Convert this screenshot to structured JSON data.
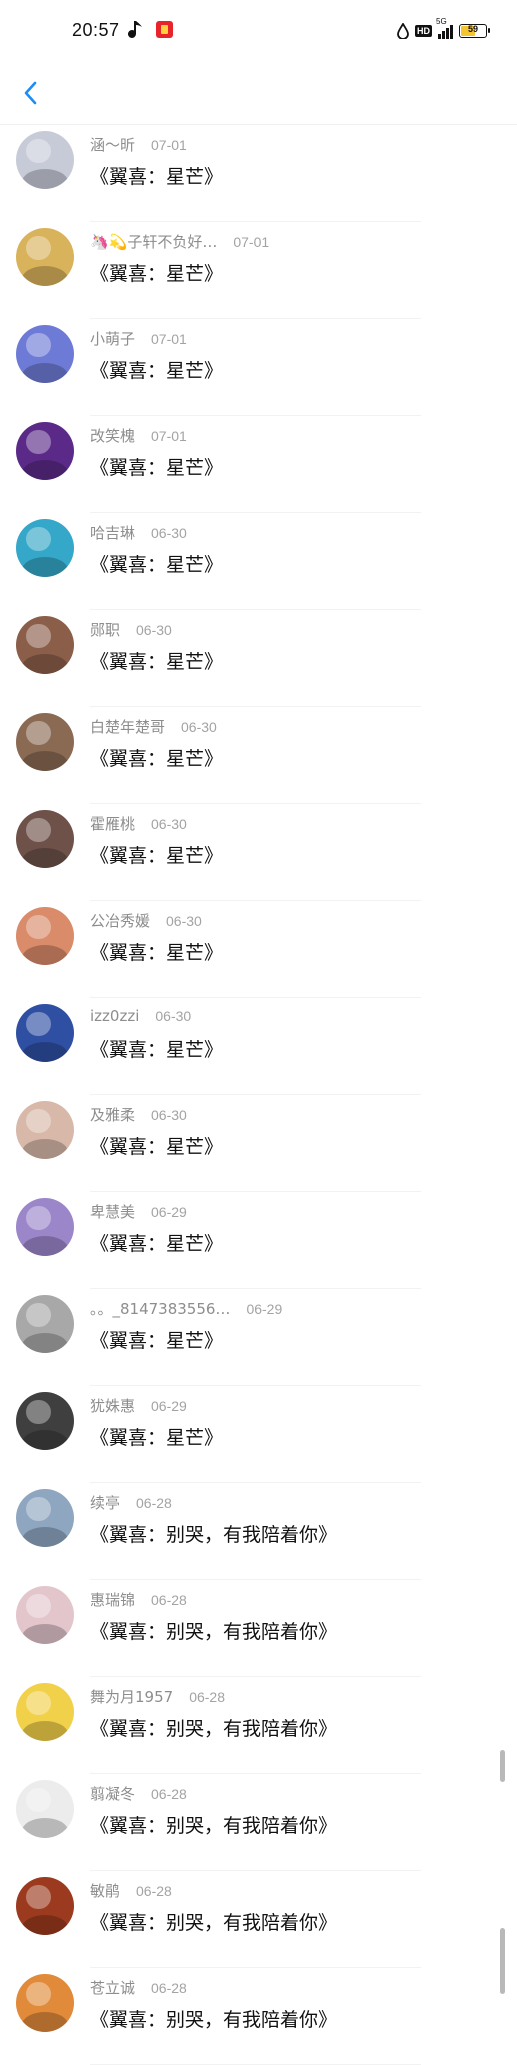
{
  "status_bar": {
    "time": "20:57",
    "network": "5G",
    "hd": "HD",
    "battery": "59",
    "battery_level": 0.59,
    "battery_color": "#f5c432"
  },
  "nav": {
    "back_icon": "chevron-left-icon",
    "accent": "#1a8ef5"
  },
  "comments": [
    {
      "name": "涵～昕",
      "date": "07-01",
      "title": "《翼喜：星芒》",
      "avatar_color": "#c7cbd8"
    },
    {
      "name": "🦄💫子轩不负好…",
      "date": "07-01",
      "title": "《翼喜：星芒》",
      "avatar_color": "#d9b35c"
    },
    {
      "name": "小萌子",
      "date": "07-01",
      "title": "《翼喜：星芒》",
      "avatar_color": "#6e7bd6"
    },
    {
      "name": "改笑槐",
      "date": "07-01",
      "title": "《翼喜：星芒》",
      "avatar_color": "#5b2a88"
    },
    {
      "name": "哈吉琳",
      "date": "06-30",
      "title": "《翼喜：星芒》",
      "avatar_color": "#35a7c8"
    },
    {
      "name": "郧职",
      "date": "06-30",
      "title": "《翼喜：星芒》",
      "avatar_color": "#8b5e4a"
    },
    {
      "name": "白楚年楚哥",
      "date": "06-30",
      "title": "《翼喜：星芒》",
      "avatar_color": "#8a6a53"
    },
    {
      "name": "霍雁桃",
      "date": "06-30",
      "title": "《翼喜：星芒》",
      "avatar_color": "#6e5149"
    },
    {
      "name": "公冶秀媛",
      "date": "06-30",
      "title": "《翼喜：星芒》",
      "avatar_color": "#d98b6a"
    },
    {
      "name": "izz0zzi",
      "date": "06-30",
      "title": "《翼喜：星芒》",
      "avatar_color": "#2f4fa3"
    },
    {
      "name": "及雅柔",
      "date": "06-30",
      "title": "《翼喜：星芒》",
      "avatar_color": "#d8b8a8"
    },
    {
      "name": "卑慧美",
      "date": "06-29",
      "title": "《翼喜：星芒》",
      "avatar_color": "#9b86c9"
    },
    {
      "name": "。。_8147383556…",
      "date": "06-29",
      "title": "《翼喜：星芒》",
      "avatar_color": "#a8a8a8"
    },
    {
      "name": "犹姝惠",
      "date": "06-29",
      "title": "《翼喜：星芒》",
      "avatar_color": "#3f3f3f"
    },
    {
      "name": "续亭",
      "date": "06-28",
      "title": "《翼喜：别哭，有我陪着你》",
      "avatar_color": "#8fa6c0"
    },
    {
      "name": "惠瑞锦",
      "date": "06-28",
      "title": "《翼喜：别哭，有我陪着你》",
      "avatar_color": "#e3c6cc"
    },
    {
      "name": "舞为月1957",
      "date": "06-28",
      "title": "《翼喜：别哭，有我陪着你》",
      "avatar_color": "#f1d04a"
    },
    {
      "name": "翦凝冬",
      "date": "06-28",
      "title": "《翼喜：别哭，有我陪着你》",
      "avatar_color": "#ececec"
    },
    {
      "name": "敏鹃",
      "date": "06-28",
      "title": "《翼喜：别哭，有我陪着你》",
      "avatar_color": "#9b3a1e"
    },
    {
      "name": "苍立诚",
      "date": "06-28",
      "title": "《翼喜：别哭，有我陪着你》",
      "avatar_color": "#e08a3a"
    }
  ]
}
